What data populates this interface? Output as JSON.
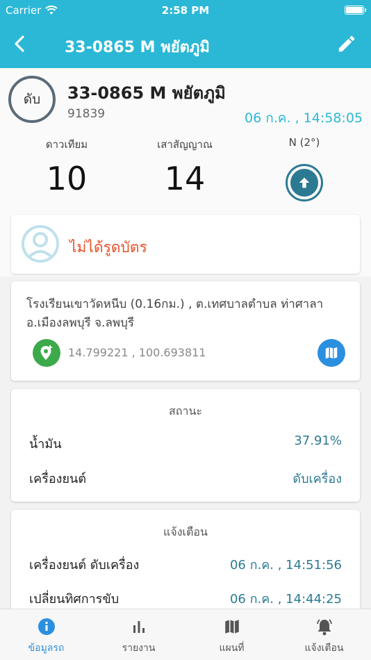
{
  "status_bar": {
    "carrier": "Carrier",
    "time": "2:58 PM"
  },
  "nav": {
    "title": "33-0865 M พยัตภูมิ"
  },
  "vehicle": {
    "status": "ดับ",
    "name": "33-0865 M พยัตภูมิ",
    "id": "91839",
    "updated": "06 ก.ค. , 14:58:05"
  },
  "stats": {
    "satellite_label": "ดาวเทียม",
    "satellite_value": "10",
    "signal_label": "เสาสัญญาณ",
    "signal_value": "14",
    "heading_label": "N (2°)"
  },
  "driver": {
    "text": "ไม่ได้รูดบัตร"
  },
  "location": {
    "address": "โรงเรียนเขาวัดหนีบ (0.16กม.) , ต.เทศบาลตำบล ท่าศาลา อ.เมืองลพบุรี จ.ลพบุรี",
    "coordinates": "14.799221 , 100.693811"
  },
  "status_card": {
    "title": "สถานะ",
    "rows": [
      {
        "label": "น้ำมัน",
        "value": "37.91%"
      },
      {
        "label": "เครื่องยนต์",
        "value": "ดับเครื่อง"
      }
    ]
  },
  "alert_card": {
    "title": "แจ้งเตือน",
    "rows": [
      {
        "label": "เครื่องยนต์ ดับเครื่อง",
        "value": "06 ก.ค. , 14:51:56"
      },
      {
        "label": "เปลี่ยนทิศการขับ",
        "value": "06 ก.ค. , 14:44:25"
      }
    ]
  },
  "tabs": [
    {
      "label": "ข้อมูลรถ",
      "icon": "info-icon",
      "active": true
    },
    {
      "label": "รายงาน",
      "icon": "bar-chart-icon",
      "active": false
    },
    {
      "label": "แผนที่",
      "icon": "map-icon",
      "active": false
    },
    {
      "label": "แจ้งเตือน",
      "icon": "bell-icon",
      "active": false
    }
  ],
  "colors": {
    "primary": "#2bb8d6",
    "accent_text": "#2b7a92",
    "warning": "#e8502a",
    "pin_green": "#3caa4a",
    "map_blue": "#2b8fe0"
  }
}
